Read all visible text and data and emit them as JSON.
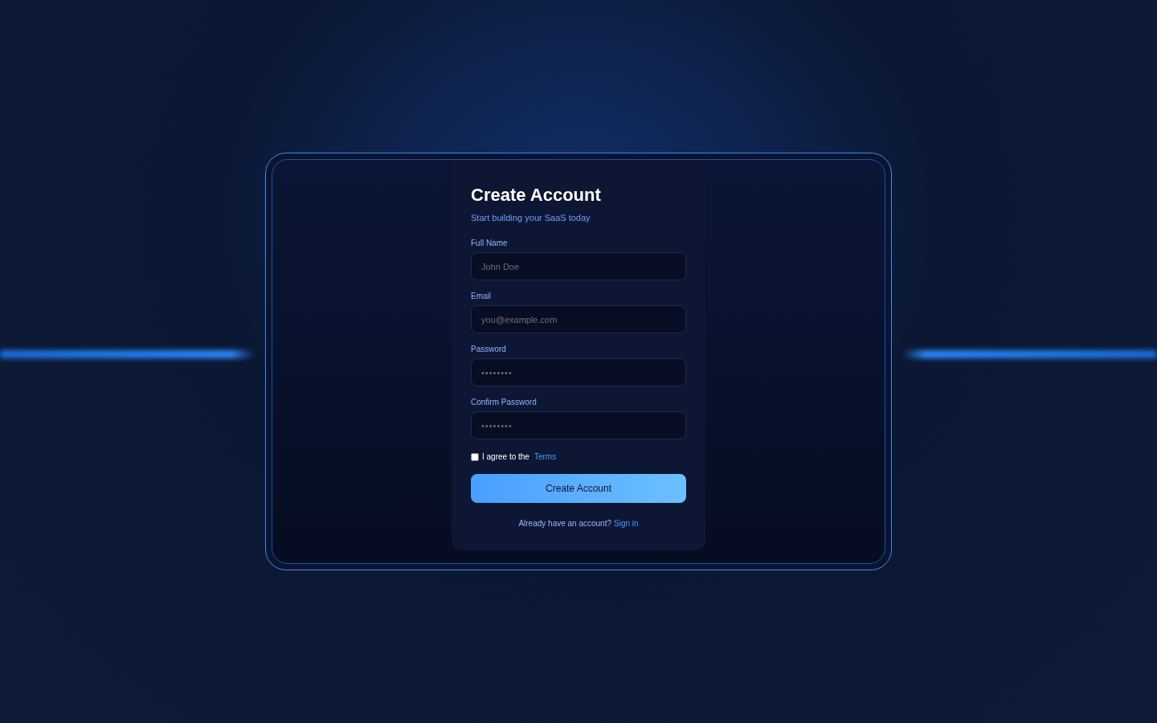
{
  "form": {
    "title": "Create Account",
    "subtitle": "Start building your SaaS today",
    "fields": [
      {
        "label": "Full Name",
        "placeholder": "John Doe",
        "kind": "text"
      },
      {
        "label": "Email",
        "placeholder": "you@example.com",
        "kind": "email"
      },
      {
        "label": "Password",
        "placeholder": "••••••••",
        "kind": "password"
      },
      {
        "label": "Confirm Password",
        "placeholder": "••••••••",
        "kind": "password"
      }
    ],
    "terms": {
      "text": "I agree to the",
      "link": "Terms",
      "checked": false
    },
    "submit": "Create Account",
    "footer": {
      "text": "Already have an account?",
      "link": "Sign in"
    }
  }
}
